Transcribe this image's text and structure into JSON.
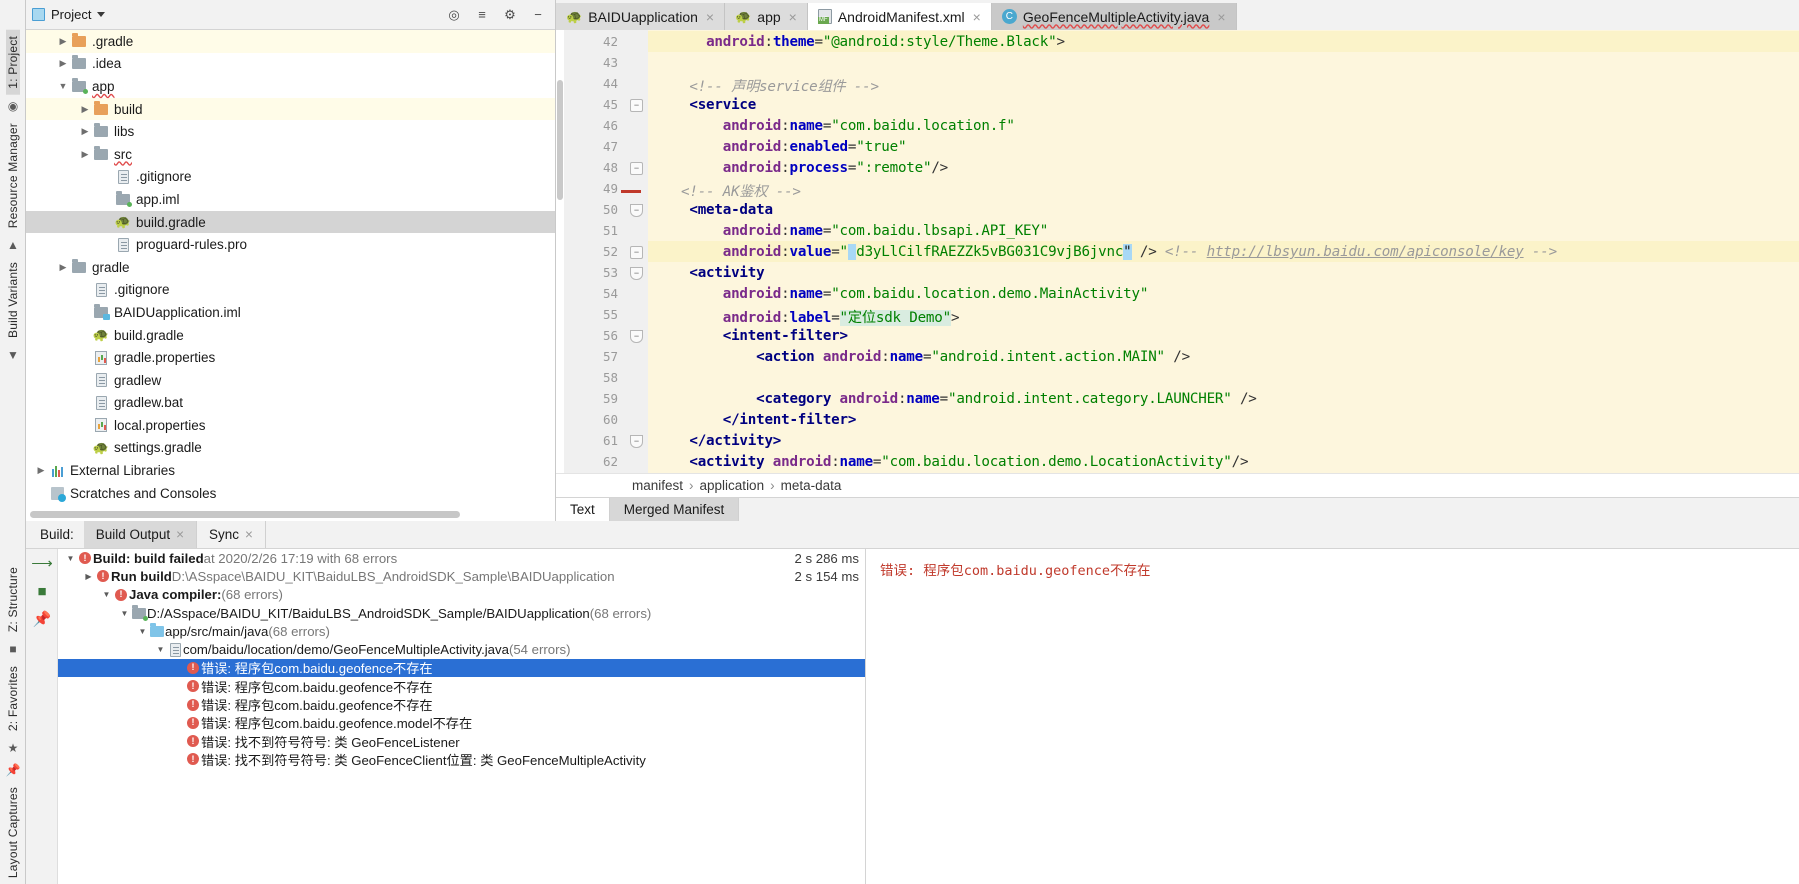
{
  "project_panel": {
    "title": "Project",
    "icons": [
      "project-dropdown-icon",
      "locate-icon",
      "collapse-all-icon",
      "gear-icon",
      "hide-icon"
    ],
    "tree": [
      {
        "label": ".gradle",
        "arrow": "right",
        "icon": "folder-orange",
        "indent": 1,
        "highlight": true
      },
      {
        "label": ".idea",
        "arrow": "right",
        "icon": "folder-gray",
        "indent": 1,
        "highlight": false
      },
      {
        "label": "app",
        "arrow": "down",
        "icon": "folder-module",
        "indent": 1,
        "highlight": false,
        "squiggle": true
      },
      {
        "label": "build",
        "arrow": "right",
        "icon": "folder-orange",
        "indent": 2,
        "highlight": true
      },
      {
        "label": "libs",
        "arrow": "right",
        "icon": "folder-gray",
        "indent": 2,
        "highlight": false
      },
      {
        "label": "src",
        "arrow": "right",
        "icon": "folder-gray",
        "indent": 2,
        "highlight": false,
        "squiggle": true
      },
      {
        "label": ".gitignore",
        "arrow": "none",
        "icon": "file-doc",
        "indent": 3,
        "highlight": false
      },
      {
        "label": "app.iml",
        "arrow": "none",
        "icon": "folder-module",
        "indent": 3,
        "highlight": false
      },
      {
        "label": "build.gradle",
        "arrow": "none",
        "icon": "gradle",
        "indent": 3,
        "highlight": false,
        "selected": true
      },
      {
        "label": "proguard-rules.pro",
        "arrow": "none",
        "icon": "file-doc",
        "indent": 3,
        "highlight": false
      },
      {
        "label": "gradle",
        "arrow": "right",
        "icon": "folder-gray",
        "indent": 1,
        "highlight": false
      },
      {
        "label": ".gitignore",
        "arrow": "none",
        "icon": "file-doc",
        "indent": 2,
        "highlight": false
      },
      {
        "label": "BAIDUapplication.iml",
        "arrow": "none",
        "icon": "folder-java-module",
        "indent": 2,
        "highlight": false
      },
      {
        "label": "build.gradle",
        "arrow": "none",
        "icon": "gradle",
        "indent": 2,
        "highlight": false
      },
      {
        "label": "gradle.properties",
        "arrow": "none",
        "icon": "properties",
        "indent": 2,
        "highlight": false
      },
      {
        "label": "gradlew",
        "arrow": "none",
        "icon": "file-doc",
        "indent": 2,
        "highlight": false
      },
      {
        "label": "gradlew.bat",
        "arrow": "none",
        "icon": "file-doc",
        "indent": 2,
        "highlight": false
      },
      {
        "label": "local.properties",
        "arrow": "none",
        "icon": "properties",
        "indent": 2,
        "highlight": false
      },
      {
        "label": "settings.gradle",
        "arrow": "none",
        "icon": "gradle",
        "indent": 2,
        "highlight": false
      },
      {
        "label": "External Libraries",
        "arrow": "right",
        "icon": "libraries",
        "indent": 0,
        "highlight": false
      },
      {
        "label": "Scratches and Consoles",
        "arrow": "none",
        "icon": "scratches",
        "indent": 0,
        "highlight": false
      }
    ]
  },
  "left_toolbar": {
    "top_items": [
      "1: Project",
      "Resource Manager",
      "Build Variants"
    ],
    "bottom_items": [
      "Z: Structure",
      "2: Favorites",
      "Layout Captures"
    ]
  },
  "editor_tabs": [
    {
      "label": "BAIDUapplication",
      "icon": "gradle-icon",
      "state": "normal",
      "close": "×"
    },
    {
      "label": "app",
      "icon": "gradle-icon",
      "state": "normal",
      "close": "×"
    },
    {
      "label": "AndroidManifest.xml",
      "icon": "manifest-icon",
      "state": "active",
      "close": "×"
    },
    {
      "label": "GeoFenceMultipleActivity.java",
      "icon": "class-icon",
      "state": "selected",
      "close": "×",
      "squiggle": true
    }
  ],
  "code": {
    "first_line": 42,
    "lines": [
      {
        "n": 42,
        "indent": 0,
        "highlight": "soft"
      },
      {
        "n": 43,
        "indent": 0
      },
      {
        "n": 44,
        "indent": 0
      },
      {
        "n": 45,
        "indent": 0,
        "fold": "minus"
      },
      {
        "n": 46,
        "indent": 0
      },
      {
        "n": 47,
        "indent": 0
      },
      {
        "n": 48,
        "indent": 0,
        "fold": "minus"
      },
      {
        "n": 49,
        "indent": 0,
        "error_stripe": true
      },
      {
        "n": 50,
        "indent": 0,
        "fold": "tri"
      },
      {
        "n": 51,
        "indent": 0
      },
      {
        "n": 52,
        "indent": 0,
        "fold": "minus",
        "caret_line": true
      },
      {
        "n": 53,
        "indent": 0,
        "fold": "tri"
      },
      {
        "n": 54,
        "indent": 0
      },
      {
        "n": 55,
        "indent": 0
      },
      {
        "n": 56,
        "indent": 0,
        "fold": "tri"
      },
      {
        "n": 57,
        "indent": 0
      },
      {
        "n": 58,
        "indent": 0
      },
      {
        "n": 59,
        "indent": 0
      },
      {
        "n": 60,
        "indent": 0
      },
      {
        "n": 61,
        "indent": 0,
        "fold": "tri"
      },
      {
        "n": 62,
        "indent": 0
      }
    ],
    "text": {
      "l42_attr": "android:theme",
      "l42_val": "\"@android:style/Theme.Black\"",
      "l42_gt": ">",
      "l44_comment": "<!-- 声明service组件 -->",
      "l45_tag": "<service",
      "l46_attr": "android:name",
      "l46_val": "\"com.baidu.location.f\"",
      "l47_attr": "android:enabled",
      "l47_val": "\"true\"",
      "l48_attr": "android:process",
      "l48_val": "\":remote\"",
      "l48_close": "/>",
      "l49_comment": "<!-- AK鉴权 -->",
      "l50_tag": "<meta-data",
      "l51_attr": "android:name",
      "l51_val": "\"com.baidu.lbsapi.API_KEY\"",
      "l52_attr": "android:value",
      "l52_val": "d3yLlCilfRAEZZk5vBG031C9vjB6jvnc",
      "l52_close": "/>",
      "l52_link_comment": "<!-- http://lbsyun.baidu.com/apiconsole/key -->",
      "l53_tag": "<activity",
      "l54_attr": "android:name",
      "l54_val": "\"com.baidu.location.demo.MainActivity\"",
      "l55_attr": "android:label",
      "l55_val": "\"定位sdk Demo\"",
      "l55_gt": ">",
      "l56_tag": "<intent-filter>",
      "l57_tag": "<action ",
      "l57_attr": "android:name",
      "l57_val": "\"android.intent.action.MAIN\"",
      "l57_close": "/>",
      "l59_tag": "<category ",
      "l59_attr": "android:name",
      "l59_val": "\"android.intent.category.LAUNCHER\"",
      "l59_close": "/>",
      "l60_tag": "</intent-filter>",
      "l61_tag": "</activity>",
      "l62_tag": "<activity ",
      "l62_attr": "android:name",
      "l62_val": "\"com.baidu.location.demo.LocationActivity\"",
      "l62_close": "/>"
    }
  },
  "breadcrumb": {
    "items": [
      "manifest",
      "application",
      "meta-data"
    ],
    "separator": "›"
  },
  "editor_bottom_tabs": [
    {
      "label": "Text",
      "active": true
    },
    {
      "label": "Merged Manifest",
      "active": false
    }
  ],
  "build_panel": {
    "label": "Build:",
    "tabs": [
      {
        "label": "Build Output",
        "active": true,
        "close": "×"
      },
      {
        "label": "Sync",
        "active": false,
        "close": "×"
      }
    ],
    "rows": [
      {
        "indent": 0,
        "arrow": "down",
        "error": true,
        "bold": "Build: build failed",
        "dim": " at 2020/2/26 17:19  with 68 errors",
        "time": "2 s 286 ms"
      },
      {
        "indent": 1,
        "arrow": "right",
        "error": true,
        "bold": "Run build",
        "dim": " D:\\ASspace\\BAIDU_KIT\\BaiduLBS_AndroidSDK_Sample\\BAIDUapplication",
        "time": "2 s 154 ms"
      },
      {
        "indent": 2,
        "arrow": "down",
        "error": true,
        "bold": "Java compiler:",
        "dim": "  (68 errors)",
        "time": ""
      },
      {
        "indent": 3,
        "arrow": "down",
        "icon": "folder-module",
        "bold": "",
        "plain": "D:/ASspace/BAIDU_KIT/BaiduLBS_AndroidSDK_Sample/BAIDUapplication",
        "dim": " (68 errors)",
        "time": ""
      },
      {
        "indent": 4,
        "arrow": "down",
        "icon": "folder-blue",
        "plain": "app/src/main/java",
        "dim": " (68 errors)",
        "time": ""
      },
      {
        "indent": 5,
        "arrow": "down",
        "icon": "java-file",
        "plain": "com/baidu/location/demo/GeoFenceMultipleActivity.java",
        "dim": " (54 errors)",
        "time": ""
      },
      {
        "indent": 6,
        "arrow": "none",
        "error": true,
        "plain": "错误: 程序包com.baidu.geofence不存在",
        "selected": true,
        "time": ""
      },
      {
        "indent": 6,
        "arrow": "none",
        "error": true,
        "plain": "错误: 程序包com.baidu.geofence不存在",
        "time": ""
      },
      {
        "indent": 6,
        "arrow": "none",
        "error": true,
        "plain": "错误: 程序包com.baidu.geofence不存在",
        "time": ""
      },
      {
        "indent": 6,
        "arrow": "none",
        "error": true,
        "plain": "错误: 程序包com.baidu.geofence.model不存在",
        "time": ""
      },
      {
        "indent": 6,
        "arrow": "none",
        "error": true,
        "plain": "错误: 找不到符号符号: 类 GeoFenceListener",
        "time": ""
      },
      {
        "indent": 6,
        "arrow": "none",
        "error": true,
        "plain": "错误: 找不到符号符号: 类 GeoFenceClient位置: 类 GeoFenceMultipleActivity",
        "time": ""
      }
    ],
    "detail_text": "错误: 程序包com.baidu.geofence不存在"
  }
}
